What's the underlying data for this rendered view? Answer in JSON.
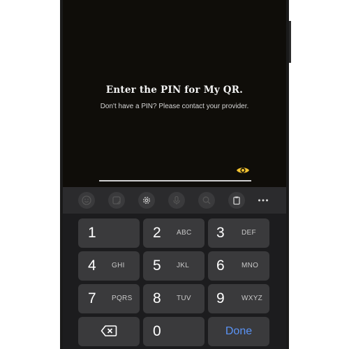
{
  "prompt": {
    "title": "Enter the PIN for My QR.",
    "subtitle": "Don't have a PIN? Please contact your provider."
  },
  "pin_field": {
    "value": "",
    "visibility_icon": "eye-icon"
  },
  "toolbar": {
    "items": [
      "emoji-icon",
      "sticker-icon",
      "settings-icon",
      "mic-icon",
      "search-icon",
      "clipboard-icon",
      "more-icon"
    ]
  },
  "keypad": {
    "keys": [
      {
        "num": "1",
        "letters": ""
      },
      {
        "num": "2",
        "letters": "ABC"
      },
      {
        "num": "3",
        "letters": "DEF"
      },
      {
        "num": "4",
        "letters": "GHI"
      },
      {
        "num": "5",
        "letters": "JKL"
      },
      {
        "num": "6",
        "letters": "MNO"
      },
      {
        "num": "7",
        "letters": "PQRS"
      },
      {
        "num": "8",
        "letters": "TUV"
      },
      {
        "num": "9",
        "letters": "WXYZ"
      },
      {
        "num": "0",
        "letters": ""
      }
    ],
    "backspace_icon": "backspace-icon",
    "done_label": "Done"
  },
  "colors": {
    "app_background": "#0f0d09",
    "accent_eye": "#f2c230",
    "done_text": "#5a93f5",
    "key_background": "#3a3a3c"
  }
}
